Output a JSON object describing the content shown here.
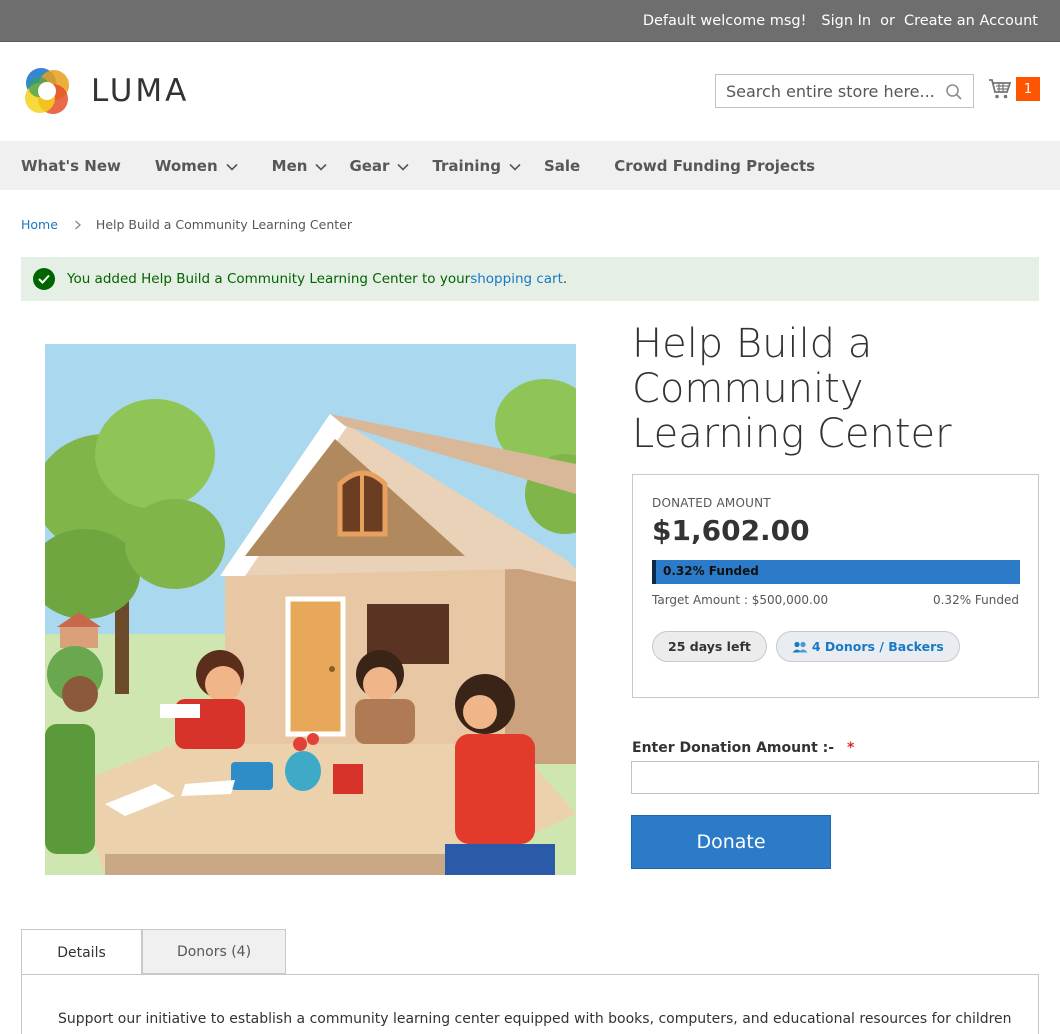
{
  "top_panel": {
    "welcome": "Default welcome msg!",
    "sign_in": "Sign In",
    "or": "or",
    "create_account": "Create an Account"
  },
  "header": {
    "logo_text": "LUMA",
    "search_placeholder": "Search entire store here...",
    "cart_count": "1"
  },
  "nav": {
    "items": [
      {
        "label": "What's New",
        "dropdown": false
      },
      {
        "label": "Women",
        "dropdown": true
      },
      {
        "label": "Men",
        "dropdown": true
      },
      {
        "label": "Gear",
        "dropdown": true
      },
      {
        "label": "Training",
        "dropdown": true
      },
      {
        "label": "Sale",
        "dropdown": false
      },
      {
        "label": "Crowd Funding Projects",
        "dropdown": false
      }
    ]
  },
  "breadcrumb": {
    "home": "Home",
    "current": "Help Build a Community Learning Center"
  },
  "message": {
    "text": "You added Help Build a Community Learning Center to your ",
    "link": "shopping cart",
    "suffix": "."
  },
  "product": {
    "title": "Help Build a Community Learning Center",
    "donated_label": "DONATED AMOUNT",
    "donated_amount": "$1,602.00",
    "funded_bar_label": "0.32% Funded",
    "funded_fraction": 0.0032,
    "target_amount": "Target Amount : $500,000.00",
    "funded_text": "0.32% Funded",
    "days_left": "25 days left",
    "donors": "4 Donors / Backers",
    "donation_label": "Enter Donation Amount :-",
    "required_mark": "*",
    "donation_value": "",
    "donate_button": "Donate"
  },
  "tabs": {
    "details": "Details",
    "donors": "Donors (4)",
    "content": "Support our initiative to establish a community learning center equipped with books, computers, and educational resources for children"
  },
  "colors": {
    "primary": "#2b7bc8",
    "link": "#1979c3",
    "cart_badge": "#ff5501",
    "success": "#006400"
  }
}
